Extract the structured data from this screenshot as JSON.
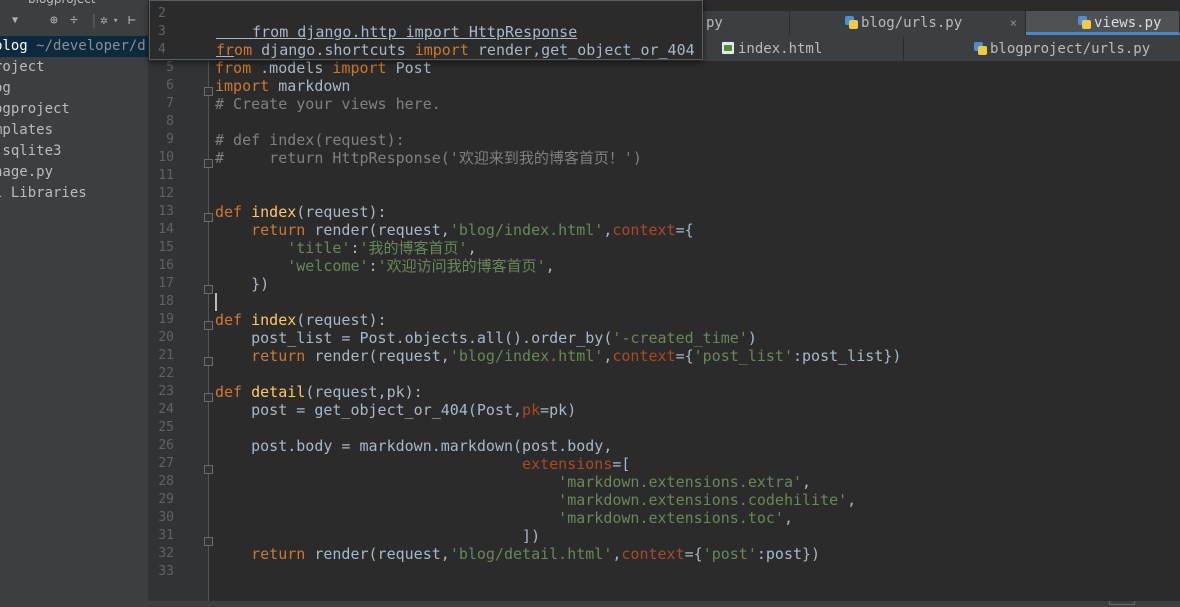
{
  "sidebar": {
    "title": "blogproject",
    "toolbar_icons": [
      "dropdown-icon",
      "target-icon",
      "collapse-icon",
      "settings-icon",
      "hide-icon"
    ],
    "items": [
      {
        "label": "blog",
        "path": "~/developer/d",
        "selected": true
      },
      {
        "label": "roject"
      },
      {
        "label": "og"
      },
      {
        "label": "ogproject"
      },
      {
        "label": "mplates"
      },
      {
        "label": ".sqlite3"
      },
      {
        "label": "nage.py"
      },
      {
        "label": "l Libraries"
      }
    ]
  },
  "tabs": {
    "row1": [
      {
        "label": "py"
      },
      {
        "label": "blog/urls.py"
      },
      {
        "label": "views.py",
        "active": true
      }
    ],
    "row2": [
      {
        "label": "index.html"
      },
      {
        "label": "blogproject/urls.py"
      }
    ],
    "close_glyph": "×"
  },
  "popup": {
    "lines": [
      {
        "num": "2",
        "text": "from django.http import HttpResponse"
      },
      {
        "num": "3",
        "text": ""
      },
      {
        "num": "4",
        "text": "from django.shortcuts import render,get_object_or_404"
      }
    ]
  },
  "code": {
    "lines": [
      {
        "num": "5",
        "text": "from .models import Post"
      },
      {
        "num": "6",
        "text": "import markdown"
      },
      {
        "num": "7",
        "text": "# Create your views here."
      },
      {
        "num": "8",
        "text": ""
      },
      {
        "num": "9",
        "text": "# def index(request):"
      },
      {
        "num": "10",
        "text": "#     return HttpResponse('欢迎来到我的博客首页！')"
      },
      {
        "num": "11",
        "text": ""
      },
      {
        "num": "12",
        "text": ""
      },
      {
        "num": "13",
        "text": "def index(request):"
      },
      {
        "num": "14",
        "text": "    return render(request,'blog/index.html',context={"
      },
      {
        "num": "15",
        "text": "        'title':'我的博客首页',"
      },
      {
        "num": "16",
        "text": "        'welcome':'欢迎访问我的博客首页',"
      },
      {
        "num": "17",
        "text": "    })"
      },
      {
        "num": "18",
        "text": ""
      },
      {
        "num": "19",
        "text": "def index(request):"
      },
      {
        "num": "20",
        "text": "    post_list = Post.objects.all().order_by('-created_time')"
      },
      {
        "num": "21",
        "text": "    return render(request,'blog/index.html',context={'post_list':post_list})"
      },
      {
        "num": "22",
        "text": ""
      },
      {
        "num": "23",
        "text": "def detail(request,pk):"
      },
      {
        "num": "24",
        "text": "    post = get_object_or_404(Post,pk=pk)"
      },
      {
        "num": "25",
        "text": ""
      },
      {
        "num": "26",
        "text": "    post.body = markdown.markdown(post.body,"
      },
      {
        "num": "27",
        "text": "                                  extensions=["
      },
      {
        "num": "28",
        "text": "                                      'markdown.extensions.extra',"
      },
      {
        "num": "29",
        "text": "                                      'markdown.extensions.codehilite',"
      },
      {
        "num": "30",
        "text": "                                      'markdown.extensions.toc',"
      },
      {
        "num": "31",
        "text": "                                  ])"
      },
      {
        "num": "32",
        "text": "    return render(request,'blog/detail.html',context={'post':post})"
      },
      {
        "num": "33",
        "text": ""
      }
    ]
  },
  "colors": {
    "background": "#2b2b2b",
    "keyword": "#cc7832",
    "function": "#ffc66d",
    "string": "#6a8759",
    "comment": "#808080",
    "param": "#aa4926",
    "text": "#a9b7c6",
    "active_tab_underline": "#4a88c7"
  }
}
